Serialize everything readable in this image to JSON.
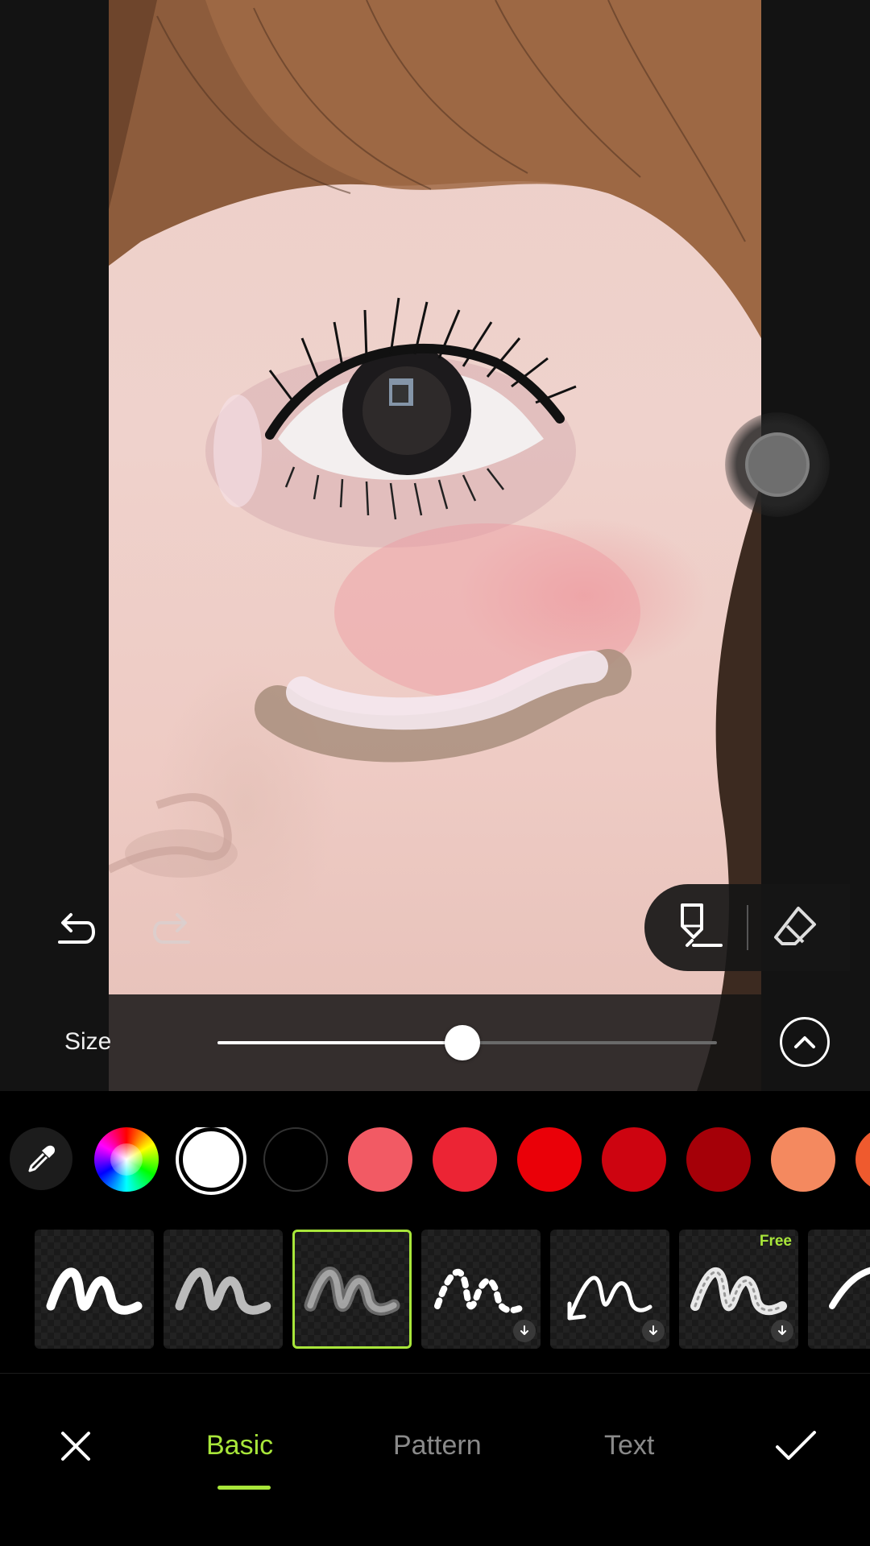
{
  "editor": {
    "size_label": "Size",
    "size_value_fraction": 0.49
  },
  "colors": {
    "swatches": [
      "#ffffff",
      "#000000",
      "#f25a64",
      "#ec2434",
      "#ea0008",
      "#cd0410",
      "#a50008",
      "#f4895f",
      "#ef5a2e"
    ],
    "selected": "#ffffff",
    "accent": "#a8e63a"
  },
  "icons": {
    "undo": "undo-icon",
    "redo": "redo-icon",
    "brush_tool": "marker-icon",
    "eraser_tool": "eraser-icon",
    "expand": "chevron-up-icon",
    "eyedropper": "eyedropper-icon",
    "close": "close-icon",
    "confirm": "check-icon"
  },
  "brushes": [
    {
      "style": "solid"
    },
    {
      "style": "glitter"
    },
    {
      "style": "soft-blur",
      "selected": true
    },
    {
      "style": "dotted",
      "download": true
    },
    {
      "style": "arrow",
      "download": true
    },
    {
      "style": "sparkle",
      "badge": "Free",
      "download": true
    },
    {
      "style": "partial"
    }
  ],
  "tabs": {
    "basic": "Basic",
    "pattern": "Pattern",
    "text": "Text",
    "active": "basic"
  }
}
